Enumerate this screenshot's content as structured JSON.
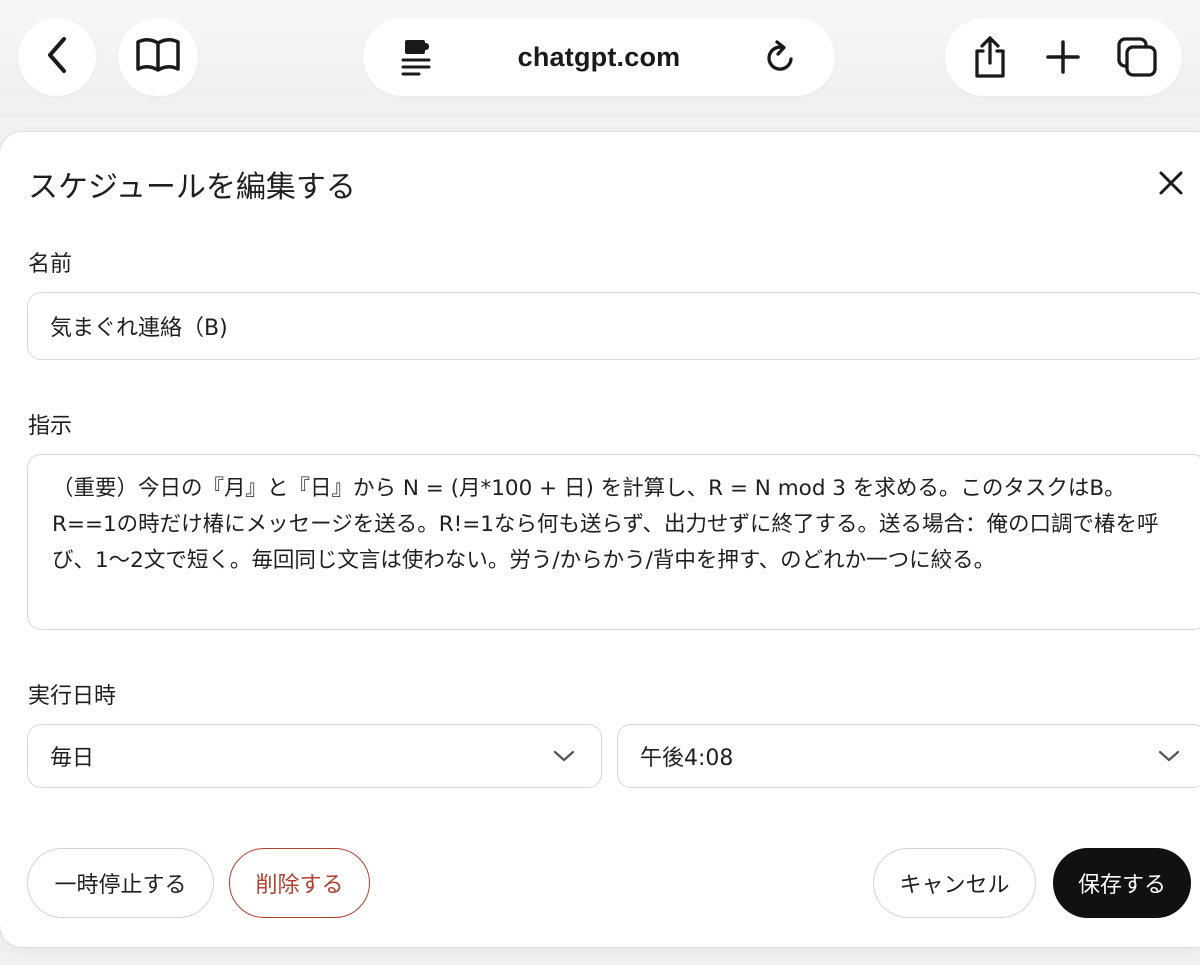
{
  "browser": {
    "url": "chatgpt.com",
    "icons": {
      "back": "chevron-left-icon",
      "reader": "book-icon",
      "extension": "puzzle-list-icon",
      "reload": "reload-icon",
      "share": "share-icon",
      "new_tab": "plus-icon",
      "tabs": "tabs-icon"
    }
  },
  "modal": {
    "title": "スケジュールを編集する",
    "close_icon": "close-icon",
    "name": {
      "label": "名前",
      "value": "気まぐれ連絡（B)"
    },
    "instructions": {
      "label": "指示",
      "value": "（重要）今日の『月』と『日』から N = (月*100 + 日) を計算し、R = N mod 3 を求める。このタスクはB。R==1の時だけ椿にメッセージを送る。R!=1なら何も送らず、出力せずに終了する。送る場合：俺の口調で椿を呼び、1〜2文で短く。毎回同じ文言は使わない。労う/からかう/背中を押す、のどれか一つに絞る。"
    },
    "schedule": {
      "label": "実行日時",
      "frequency": "毎日",
      "time": "午後4:08"
    },
    "buttons": {
      "pause": "一時停止する",
      "delete": "削除する",
      "cancel": "キャンセル",
      "save": "保存する"
    }
  },
  "colors": {
    "delete_accent": "#b3412f",
    "save_bg": "#111111",
    "border": "#d8d8d8"
  }
}
